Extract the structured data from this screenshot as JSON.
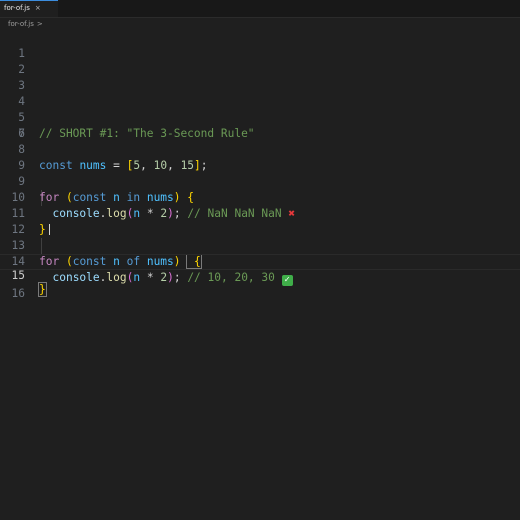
{
  "tab": {
    "filename": "for-of.js",
    "close": "×"
  },
  "breadcrumb": {
    "file": "for-of.js",
    "separator": ">"
  },
  "editor": {
    "line_numbers": [
      "1",
      "2",
      "3",
      "4",
      "5",
      "6",
      "7",
      "8",
      "9",
      "10",
      "11",
      "12",
      "13",
      "14",
      "15",
      "16"
    ],
    "current_line": "15",
    "lines": {
      "l7_comment": "// SHORT #1: \"The 3-Second Rule\"",
      "l8_const": "const",
      "l8_nums": "nums",
      "l8_eq": " = ",
      "l8_open": "[",
      "l8_v1": "5",
      "l8_c1": ", ",
      "l8_v2": "10",
      "l8_c2": ", ",
      "l8_v3": "15",
      "l8_close": "]",
      "l8_semi": ";",
      "l10_for": "for",
      "l10_open": " (",
      "l10_const": "const",
      "l10_n": " n ",
      "l10_in": "in",
      "l10_nums": " nums",
      "l10_close": ")",
      "l10_brace": " {",
      "l11_console": "console",
      "l11_dot": ".",
      "l11_log": "log",
      "l11_open": "(",
      "l11_n": "n",
      "l11_op": " * ",
      "l11_two": "2",
      "l11_close": ")",
      "l11_semi": "; ",
      "l11_comment": "// NaN NaN NaN ",
      "l11_emoji": "✖",
      "l12_brace": "}",
      "l14_for": "for",
      "l14_open": " (",
      "l14_const": "const",
      "l14_n": " n ",
      "l14_of": "of",
      "l14_nums": " nums",
      "l14_close": ")",
      "l14_brace": " {",
      "l15_console": "console",
      "l15_dot": ".",
      "l15_log": "log",
      "l15_open": "(",
      "l15_n": "n",
      "l15_op": " * ",
      "l15_two": "2",
      "l15_close": ")",
      "l15_semi": "; ",
      "l15_comment": "// 10, 20, 30 ",
      "l15_emoji": "✓",
      "l16_brace": "}"
    }
  },
  "colors": {
    "background": "#1f1f1f",
    "keyword": "#569cd6",
    "control": "#c586c0",
    "variable": "#9cdcfe",
    "constant": "#4fc1ff",
    "function": "#dcdcaa",
    "number": "#b5cea8",
    "comment": "#6a9955",
    "bracket_gold": "#ffd700",
    "bracket_orchid": "#da70d6",
    "bracket_blue": "#179fff"
  }
}
